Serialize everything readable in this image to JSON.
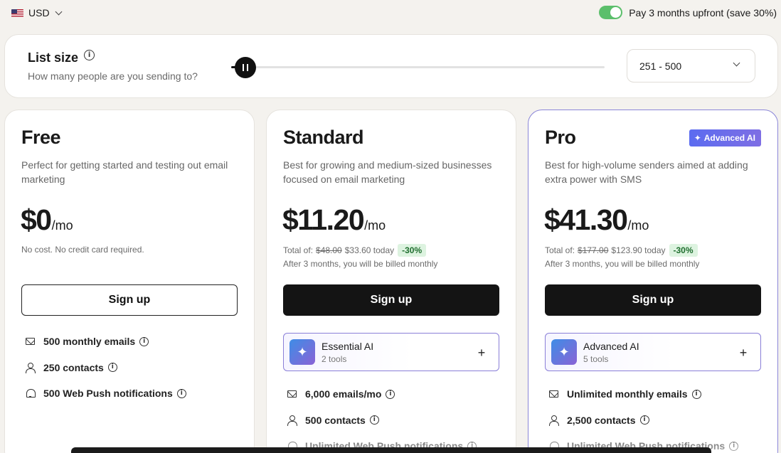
{
  "currency": {
    "flag": "us-flag-icon",
    "label": "USD"
  },
  "upfront": {
    "enabled": true,
    "label": "Pay 3 months upfront (save 30%)"
  },
  "list_size": {
    "title": "List size",
    "subtitle": "How many people are you sending to?",
    "slider_level": 0.0,
    "selected": "251 - 500"
  },
  "plans": [
    {
      "name": "Free",
      "description": "Perfect for getting started and testing out email marketing",
      "price": "$0",
      "period": "/mo",
      "note": "No cost. No credit card required.",
      "button": "Sign up",
      "features": [
        {
          "icon": "mail-icon",
          "text": "500 monthly emails"
        },
        {
          "icon": "user-icon",
          "text": "250 contacts"
        },
        {
          "icon": "bell-icon",
          "text": "500 Web Push notifications"
        }
      ]
    },
    {
      "name": "Standard",
      "description": "Best for growing and medium-sized businesses focused on email marketing",
      "price": "$11.20",
      "period": "/mo",
      "total_label": "Total of:",
      "total_old": "$48.00",
      "total_new": "$33.60 today",
      "discount": "-30%",
      "billed": "After 3 months, you will be billed monthly",
      "button": "Sign up",
      "addon": {
        "name": "Essential AI",
        "sub": "2 tools"
      },
      "features": [
        {
          "icon": "mail-icon",
          "text": "6,000 emails/mo"
        },
        {
          "icon": "user-icon",
          "text": "500 contacts"
        },
        {
          "icon": "bell-icon",
          "text": "Unlimited Web Push notifications"
        }
      ]
    },
    {
      "name": "Pro",
      "badge": "Advanced AI",
      "description": "Best for high-volume senders aimed at adding extra power with SMS",
      "price": "$41.30",
      "period": "/mo",
      "total_label": "Total of:",
      "total_old": "$177.00",
      "total_new": "$123.90 today",
      "discount": "-30%",
      "billed": "After 3 months, you will be billed monthly",
      "button": "Sign up",
      "addon": {
        "name": "Advanced AI",
        "sub": "5 tools"
      },
      "features": [
        {
          "icon": "mail-icon",
          "text": "Unlimited monthly emails"
        },
        {
          "icon": "user-icon",
          "text": "2,500 contacts"
        },
        {
          "icon": "bell-icon",
          "text": "Unlimited Web Push notifications"
        }
      ]
    }
  ]
}
